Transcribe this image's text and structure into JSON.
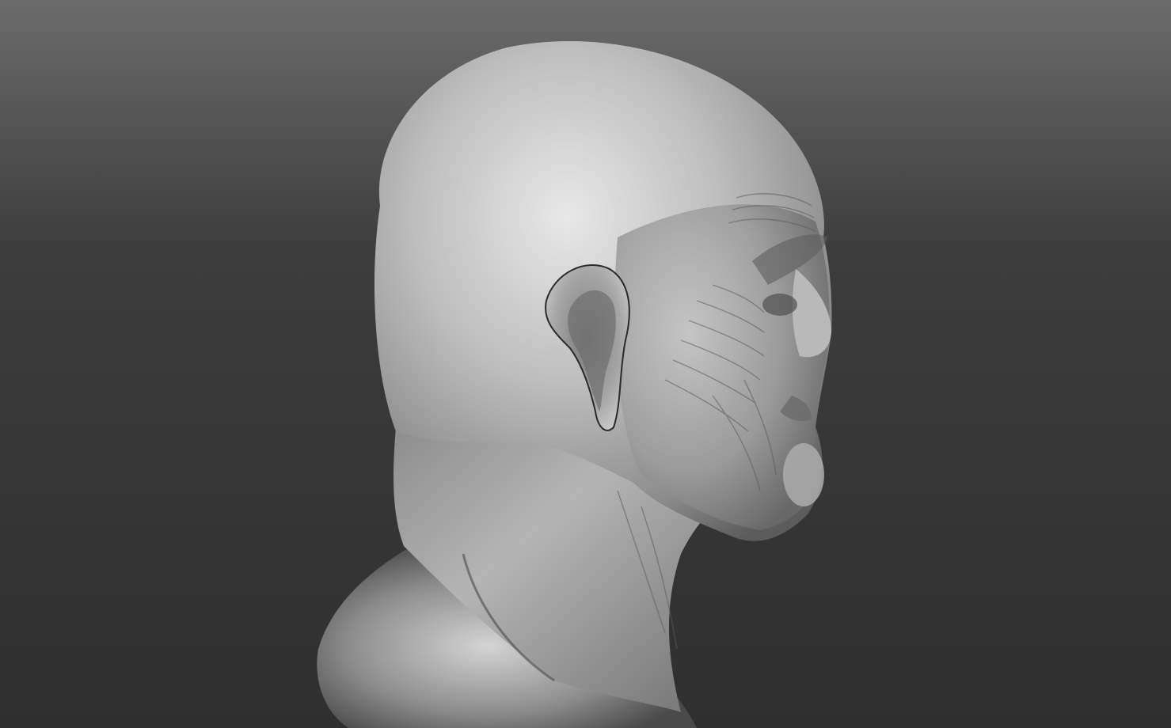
{
  "viewport": {
    "background_top": "#6a6a6a",
    "background_bottom": "#2e2e2e",
    "model_base_color": "#9a9a9a",
    "model_highlight_color": "#d8d8d8",
    "model_shadow_color": "#3a3a3a",
    "model_subject": "sculpted-elderly-head-bust-profile"
  }
}
